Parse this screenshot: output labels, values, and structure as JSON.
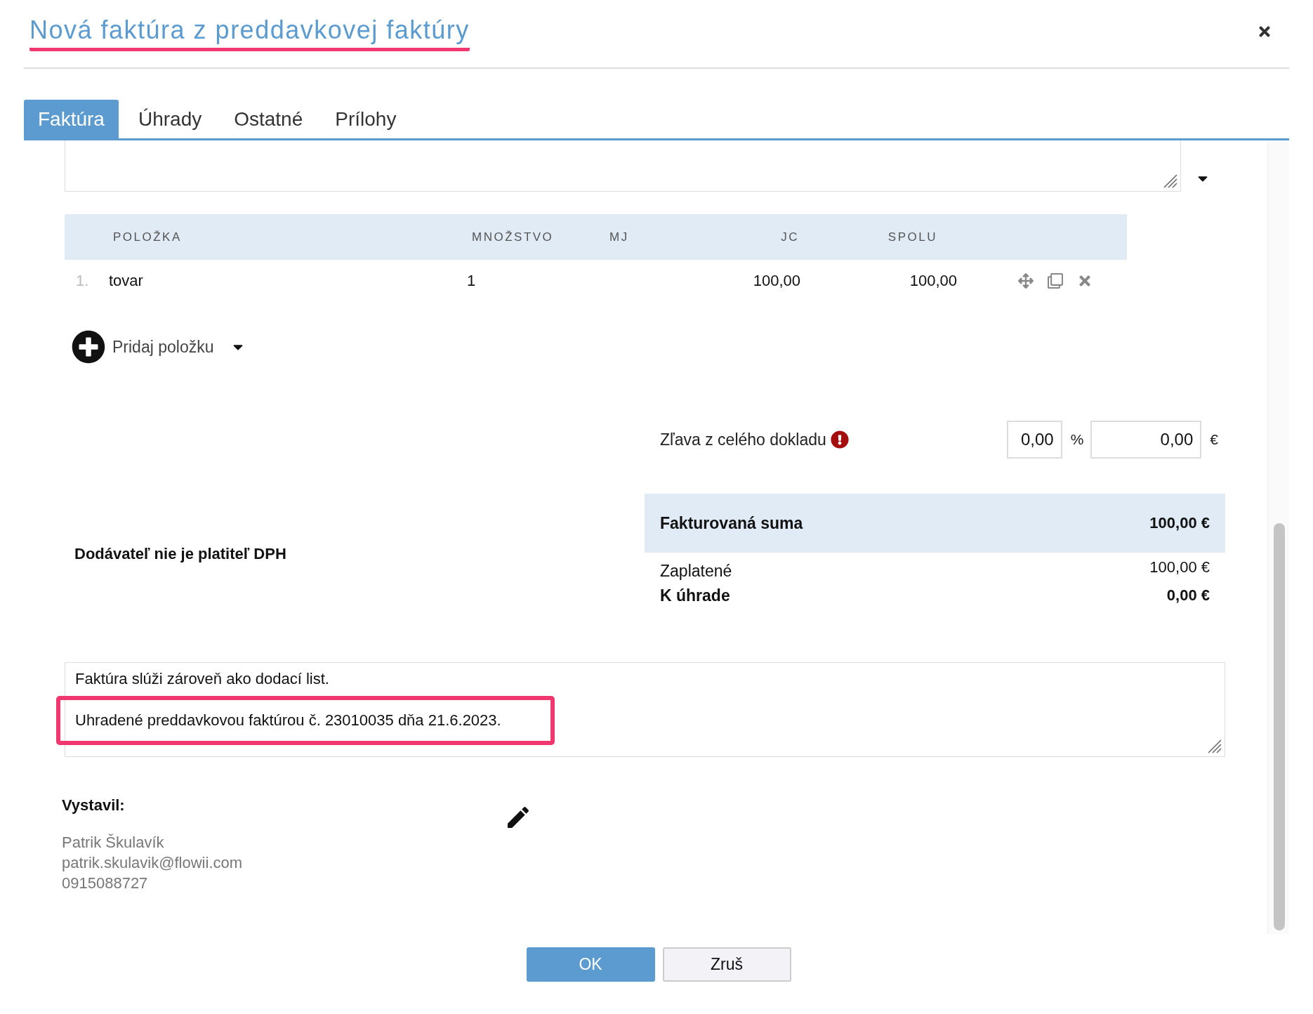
{
  "dialog": {
    "title": "Nová faktúra z preddavkovej faktúry",
    "title_highlighted": true
  },
  "tabs": [
    {
      "label": "Faktúra",
      "selected": true
    },
    {
      "label": "Úhrady",
      "selected": false
    },
    {
      "label": "Ostatné",
      "selected": false
    },
    {
      "label": "Prílohy",
      "selected": false
    }
  ],
  "table": {
    "columns": [
      "POLOŽKA",
      "MNOŽSTVO",
      "MJ",
      "JC",
      "SPOLU"
    ],
    "rows": [
      {
        "index": "1.",
        "item": "tovar",
        "quantity": "1",
        "unit_price": "100,00",
        "total": "100,00"
      }
    ]
  },
  "add_item": {
    "label": "Pridaj položku"
  },
  "discount": {
    "label": "Zľava z celého dokladu",
    "warning": true,
    "percent_value": "0,00",
    "percent_sign": "%",
    "amount_value": "0,00",
    "currency": "€"
  },
  "vat_note": "Dodávateľ nie je platiteľ DPH",
  "totals": [
    {
      "label": "Fakturovaná suma",
      "value": "100,00 €",
      "kind": "total"
    },
    {
      "label": "Zaplatené",
      "value": "100,00 €",
      "kind": "plain"
    },
    {
      "label": "K úhrade",
      "value": "0,00 €",
      "kind": "bold"
    }
  ],
  "notes": [
    {
      "text": "Faktúra slúži zároveň ako dodací list.",
      "highlighted": false
    },
    {
      "text": "Uhradené preddavkovou faktúrou č. 23010035 dňa 21.6.2023.",
      "highlighted": true
    }
  ],
  "issuer": {
    "label": "Vystavil:",
    "lines": [
      "Patrik Škulavík",
      "patrik.skulavik@flowii.com",
      "0915088727"
    ]
  },
  "buttons": [
    {
      "label": "OK",
      "kind": "primary"
    },
    {
      "label": "Zruš",
      "kind": "secondary"
    }
  ]
}
